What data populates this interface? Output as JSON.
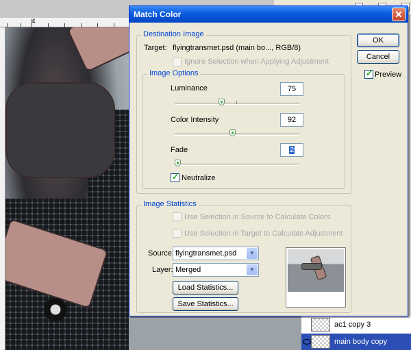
{
  "ruler": {
    "mark": "4"
  },
  "dialog": {
    "title": "Match Color",
    "close_glyph": "✕",
    "ok_label": "OK",
    "cancel_label": "Cancel",
    "preview_label": "Preview",
    "preview_checked": true,
    "destination": {
      "legend": "Destination Image",
      "target_label": "Target:",
      "target_value": "flyingtransmet.psd (main bo..., RGB/8)",
      "ignore_selection_label": "Ignore Selection when Applying Adjustment"
    },
    "image_options": {
      "legend": "Image Options",
      "luminance_label": "Luminance",
      "luminance_value": "75",
      "luminance_fraction": 0.375,
      "color_intensity_label": "Color Intensity",
      "color_intensity_value": "92",
      "color_intensity_fraction": 0.46,
      "fade_label": "Fade",
      "fade_value": "2",
      "fade_fraction": 0.02,
      "neutralize_label": "Neutralize",
      "neutralize_checked": true
    },
    "image_statistics": {
      "legend": "Image Statistics",
      "use_source_label": "Use Selection in Source to Calculate Colors",
      "use_target_label": "Use Selection in Target to Calculate Adjustment",
      "source_label": "Source:",
      "source_value": "flyingtransmet.psd",
      "layer_label": "Layer:",
      "layer_value": "Merged",
      "load_label": "Load Statistics...",
      "save_label": "Save Statistics..."
    }
  },
  "layers": [
    {
      "name": "ac1 copy 3",
      "selected": false
    },
    {
      "name": "main body copy",
      "selected": true
    }
  ],
  "colors": {
    "accent": "#0046d5",
    "title_bar": "#0a5bdd",
    "selected_layer": "#2c4fb5"
  }
}
